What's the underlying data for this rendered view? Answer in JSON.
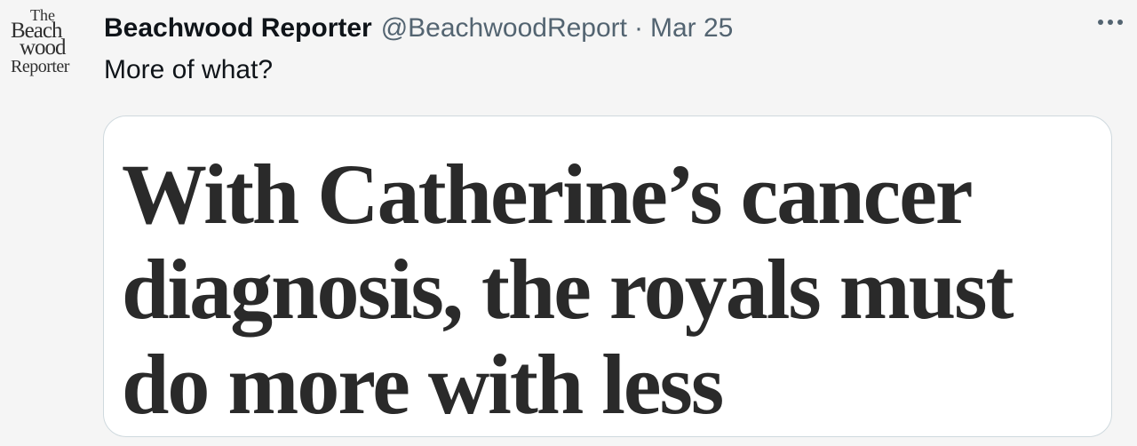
{
  "avatar": {
    "logo_lines": [
      "The",
      "Beach",
      "wood",
      "Reporter"
    ]
  },
  "tweet": {
    "display_name": "Beachwood Reporter",
    "handle": "@BeachwoodReport",
    "separator": "·",
    "date": "Mar 25",
    "more_icon": "more-dots-icon",
    "text": "More of what?"
  },
  "media": {
    "headline": "With Catherine’s cancer diagnosis, the royals must do more with less"
  },
  "colors": {
    "background": "#f5f5f5",
    "primary_text": "#0f1419",
    "secondary_text": "#536471",
    "card_border": "#cfd9de",
    "headline_text": "#2a2a2a"
  }
}
